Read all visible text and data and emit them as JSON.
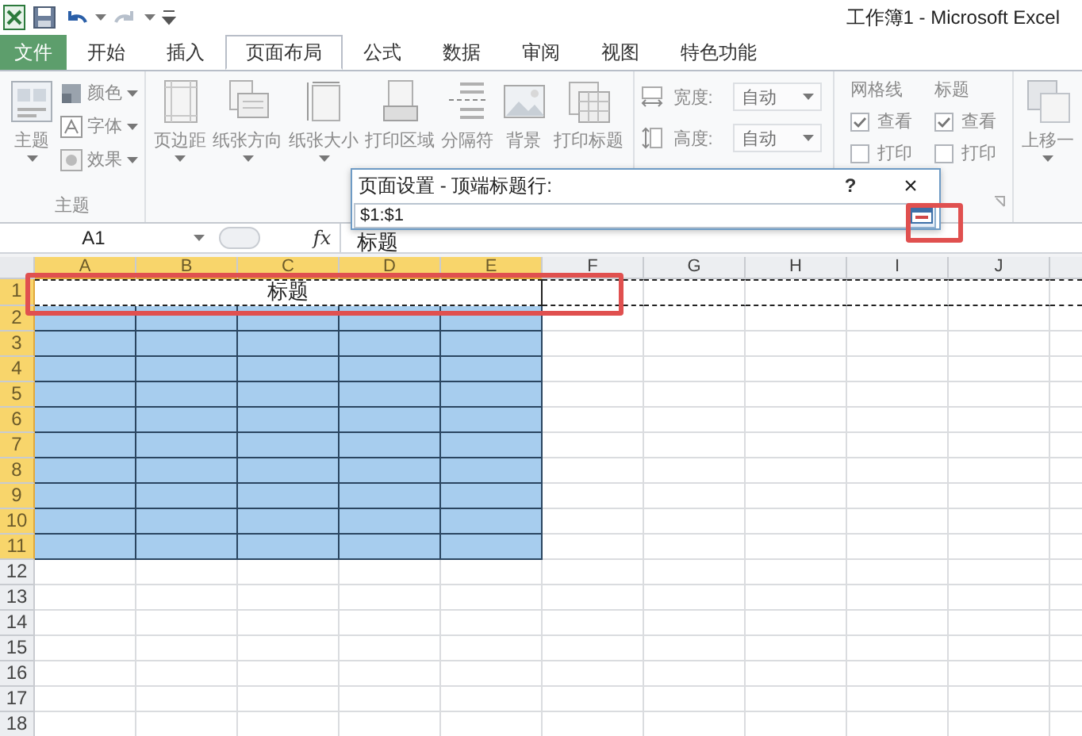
{
  "window": {
    "title": "工作簿1 - Microsoft Excel"
  },
  "tabs": [
    {
      "label": "文件",
      "kind": "file",
      "selected": false
    },
    {
      "label": "开始",
      "kind": "tab",
      "selected": false
    },
    {
      "label": "插入",
      "kind": "tab",
      "selected": false
    },
    {
      "label": "页面布局",
      "kind": "tab",
      "selected": true
    },
    {
      "label": "公式",
      "kind": "tab",
      "selected": false
    },
    {
      "label": "数据",
      "kind": "tab",
      "selected": false
    },
    {
      "label": "审阅",
      "kind": "tab",
      "selected": false
    },
    {
      "label": "视图",
      "kind": "tab",
      "selected": false
    },
    {
      "label": "特色功能",
      "kind": "tab",
      "selected": false
    }
  ],
  "ribbon": {
    "groups": [
      {
        "kind": "themes",
        "label": "主题",
        "big_button": "主题",
        "items": [
          {
            "label": "颜色"
          },
          {
            "label": "字体"
          },
          {
            "label": "效果"
          }
        ]
      },
      {
        "kind": "page_setup",
        "buttons": [
          {
            "label": "页边距",
            "dropdown": true
          },
          {
            "label": "纸张方向",
            "dropdown": true
          },
          {
            "label": "纸张大小",
            "dropdown": true
          },
          {
            "label": "打印区域",
            "dropdown": false
          },
          {
            "label": "分隔符",
            "dropdown": false
          },
          {
            "label": "背景",
            "dropdown": false
          },
          {
            "label": "打印标题",
            "dropdown": false
          }
        ]
      },
      {
        "kind": "scale",
        "fields": [
          {
            "label": "宽度:",
            "value": "自动"
          },
          {
            "label": "高度:",
            "value": "自动"
          }
        ]
      },
      {
        "kind": "sheet_options",
        "columns": [
          {
            "label": "网格线",
            "options": [
              {
                "label": "查看",
                "checked": true
              },
              {
                "label": "打印",
                "checked": false
              }
            ]
          },
          {
            "label": "标题",
            "options": [
              {
                "label": "查看",
                "checked": true
              },
              {
                "label": "打印",
                "checked": false
              }
            ]
          }
        ]
      },
      {
        "kind": "arrange",
        "buttons": [
          {
            "label": "上移一"
          }
        ]
      }
    ]
  },
  "dialog": {
    "title": "页面设置 - 顶端标题行:",
    "help": "?",
    "close": "×",
    "value": "$1:$1",
    "collapse_highlighted": true
  },
  "formula_bar": {
    "name_box": "A1",
    "function_label": "fx",
    "value": "标题"
  },
  "sheet": {
    "columns": [
      {
        "label": "A",
        "selected": true
      },
      {
        "label": "B",
        "selected": true
      },
      {
        "label": "C",
        "selected": true
      },
      {
        "label": "D",
        "selected": true
      },
      {
        "label": "E",
        "selected": true
      },
      {
        "label": "F",
        "selected": false
      },
      {
        "label": "G",
        "selected": false
      },
      {
        "label": "H",
        "selected": false
      },
      {
        "label": "I",
        "selected": false
      },
      {
        "label": "J",
        "selected": false
      }
    ],
    "rows": [
      {
        "label": "1",
        "selected": true,
        "title": "标题",
        "marquee": true,
        "highlighted": true
      },
      {
        "label": "2",
        "selected": true
      },
      {
        "label": "3",
        "selected": true
      },
      {
        "label": "4",
        "selected": true
      },
      {
        "label": "5",
        "selected": true
      },
      {
        "label": "6",
        "selected": true
      },
      {
        "label": "7",
        "selected": true
      },
      {
        "label": "8",
        "selected": true
      },
      {
        "label": "9",
        "selected": true
      },
      {
        "label": "10",
        "selected": true
      },
      {
        "label": "11",
        "selected": true
      },
      {
        "label": "12",
        "selected": false
      },
      {
        "label": "13",
        "selected": false
      },
      {
        "label": "14",
        "selected": false
      },
      {
        "label": "15",
        "selected": false
      },
      {
        "label": "16",
        "selected": false
      },
      {
        "label": "17",
        "selected": false
      },
      {
        "label": "18",
        "selected": false
      }
    ]
  }
}
